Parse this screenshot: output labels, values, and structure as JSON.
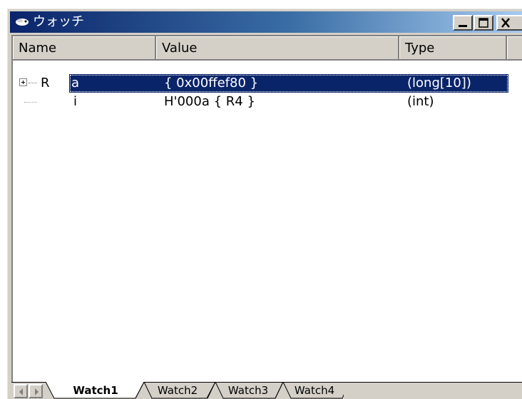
{
  "window": {
    "title": "ウォッチ",
    "app_icon": "watch-app-icon",
    "controls": [
      "minimize-icon",
      "maximize-icon",
      "close-icon"
    ]
  },
  "columns": [
    "Name",
    "Value",
    "Type"
  ],
  "rows": [
    {
      "name": "a",
      "value": "{ 0x00ffef80 }",
      "type": "(long[10])",
      "selected": true,
      "expandable": true,
      "icon": "register-icon",
      "icon_glyph": "R"
    },
    {
      "name": "i",
      "value": "H'000a { R4 }",
      "type": "(int)",
      "selected": false,
      "expandable": false
    }
  ],
  "tabs": [
    {
      "label": "Watch1",
      "active": true
    },
    {
      "label": "Watch2",
      "active": false
    },
    {
      "label": "Watch3",
      "active": false
    },
    {
      "label": "Watch4",
      "active": false
    }
  ],
  "colors": {
    "selection": "#0a246a",
    "title_start": "#0a246a",
    "title_end": "#a6caf0",
    "face": "#d4d0c8"
  }
}
